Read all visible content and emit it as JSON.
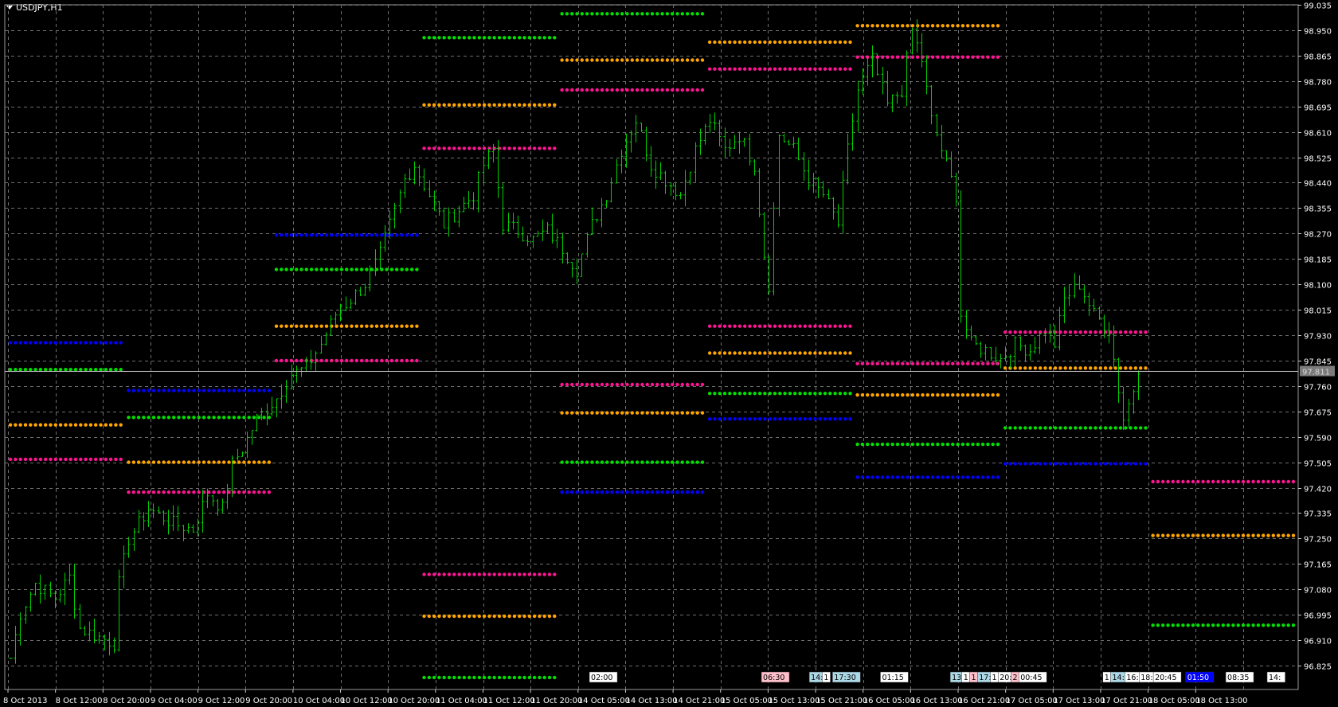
{
  "window": {
    "title": "USDJPY,H1"
  },
  "colors": {
    "background": "#000000",
    "grid": "#6f6f6f",
    "candle": "#00d000",
    "current_line": "#b8b8b8",
    "axis_text": "#ffffff",
    "level_green": "#00e000",
    "level_orange": "#ffa500",
    "level_magenta": "#ff1493",
    "level_blue": "#0000ff"
  },
  "current_price_label": "97.811",
  "chart_data": {
    "type": "candlestick",
    "symbol": "USDJPY",
    "timeframe": "H1",
    "grid": true,
    "ylim": [
      96.78,
      99.035
    ],
    "y_ticks": [
      "99.035",
      "98.950",
      "98.865",
      "98.780",
      "98.695",
      "98.610",
      "98.525",
      "98.440",
      "98.355",
      "98.270",
      "98.185",
      "98.100",
      "98.015",
      "97.930",
      "97.845",
      "97.760",
      "97.675",
      "97.590",
      "97.505",
      "97.420",
      "97.335",
      "97.250",
      "97.165",
      "97.080",
      "96.995",
      "96.910",
      "96.825"
    ],
    "x_ticks": [
      "8 Oct 2013",
      "8 Oct 12:00",
      "8 Oct 20:00",
      "9 Oct 04:00",
      "9 Oct 12:00",
      "9 Oct 20:00",
      "10 Oct 04:00",
      "10 Oct 12:00",
      "10 Oct 20:00",
      "11 Oct 04:00",
      "11 Oct 12:00",
      "11 Oct 20:00",
      "14 Oct 05:00",
      "14 Oct 13:00",
      "14 Oct 21:00",
      "15 Oct 05:00",
      "15 Oct 13:00",
      "15 Oct 21:00",
      "16 Oct 05:00",
      "16 Oct 13:00",
      "16 Oct 21:00",
      "17 Oct 05:00",
      "17 Oct 13:00",
      "17 Oct 21:00",
      "18 Oct 05:00",
      "18 Oct 13:00"
    ],
    "current_price": 97.811,
    "path_keypoints": [
      [
        0,
        96.85
      ],
      [
        2,
        97.0
      ],
      [
        5,
        97.1
      ],
      [
        9,
        97.05
      ],
      [
        12,
        97.12
      ],
      [
        14,
        96.95
      ],
      [
        18,
        96.92
      ],
      [
        21,
        96.9
      ],
      [
        22,
        97.1
      ],
      [
        24,
        97.25
      ],
      [
        28,
        97.35
      ],
      [
        33,
        97.3
      ],
      [
        37,
        97.28
      ],
      [
        40,
        97.4
      ],
      [
        43,
        97.35
      ],
      [
        45,
        97.5
      ],
      [
        47,
        97.55
      ],
      [
        50,
        97.65
      ],
      [
        54,
        97.72
      ],
      [
        57,
        97.8
      ],
      [
        60,
        97.82
      ],
      [
        63,
        97.9
      ],
      [
        66,
        98.0
      ],
      [
        69,
        98.05
      ],
      [
        72,
        98.1
      ],
      [
        75,
        98.2
      ],
      [
        77,
        98.3
      ],
      [
        80,
        98.45
      ],
      [
        82,
        98.5
      ],
      [
        85,
        98.4
      ],
      [
        88,
        98.3
      ],
      [
        91,
        98.35
      ],
      [
        94,
        98.4
      ],
      [
        96,
        98.5
      ],
      [
        98,
        98.55
      ],
      [
        100,
        98.3
      ],
      [
        103,
        98.28
      ],
      [
        106,
        98.25
      ],
      [
        109,
        98.28
      ],
      [
        112,
        98.22
      ],
      [
        115,
        98.15
      ],
      [
        118,
        98.3
      ],
      [
        121,
        98.4
      ],
      [
        124,
        98.55
      ],
      [
        127,
        98.65
      ],
      [
        130,
        98.5
      ],
      [
        133,
        98.45
      ],
      [
        136,
        98.4
      ],
      [
        139,
        98.55
      ],
      [
        142,
        98.65
      ],
      [
        145,
        98.55
      ],
      [
        148,
        98.6
      ],
      [
        151,
        98.5
      ],
      [
        153,
        98.2
      ],
      [
        154,
        98.1
      ],
      [
        156,
        98.6
      ],
      [
        159,
        98.55
      ],
      [
        162,
        98.45
      ],
      [
        165,
        98.4
      ],
      [
        168,
        98.3
      ],
      [
        170,
        98.55
      ],
      [
        172,
        98.75
      ],
      [
        175,
        98.85
      ],
      [
        178,
        98.7
      ],
      [
        181,
        98.75
      ],
      [
        183,
        98.95
      ],
      [
        185,
        98.85
      ],
      [
        187,
        98.65
      ],
      [
        190,
        98.5
      ],
      [
        192,
        98.4
      ],
      [
        193,
        98.0
      ],
      [
        195,
        97.9
      ],
      [
        198,
        97.88
      ],
      [
        201,
        97.85
      ],
      [
        204,
        97.9
      ],
      [
        207,
        97.88
      ],
      [
        210,
        97.95
      ],
      [
        212,
        97.9
      ],
      [
        214,
        98.05
      ],
      [
        217,
        98.1
      ],
      [
        220,
        98.0
      ],
      [
        223,
        97.95
      ],
      [
        225,
        97.75
      ],
      [
        226,
        97.65
      ],
      [
        228,
        97.75
      ],
      [
        229,
        97.8
      ]
    ],
    "level_sets": [
      {
        "x0": 0,
        "x1": 24,
        "levels": [
          {
            "color": "blue",
            "price": 97.905
          },
          {
            "color": "green",
            "price": 97.815
          },
          {
            "color": "orange",
            "price": 97.63
          },
          {
            "color": "magenta",
            "price": 97.515
          }
        ]
      },
      {
        "x0": 24,
        "x1": 54,
        "levels": [
          {
            "color": "blue",
            "price": 97.745
          },
          {
            "color": "green",
            "price": 97.655
          },
          {
            "color": "orange",
            "price": 97.505
          },
          {
            "color": "magenta",
            "price": 97.405
          }
        ]
      },
      {
        "x0": 54,
        "x1": 84,
        "levels": [
          {
            "color": "blue",
            "price": 98.265
          },
          {
            "color": "green",
            "price": 98.15
          },
          {
            "color": "orange",
            "price": 97.96
          },
          {
            "color": "magenta",
            "price": 97.845
          }
        ]
      },
      {
        "x0": 84,
        "x1": 112,
        "levels": [
          {
            "color": "green",
            "price": 98.925
          },
          {
            "color": "orange",
            "price": 98.7
          },
          {
            "color": "magenta",
            "price": 98.555
          },
          {
            "color": "magenta",
            "price": 97.13
          },
          {
            "color": "orange",
            "price": 96.99
          },
          {
            "color": "green",
            "price": 96.785
          }
        ]
      },
      {
        "x0": 112,
        "x1": 142,
        "levels": [
          {
            "color": "green",
            "price": 99.005
          },
          {
            "color": "orange",
            "price": 98.85
          },
          {
            "color": "magenta",
            "price": 98.75
          },
          {
            "color": "magenta",
            "price": 97.765
          },
          {
            "color": "orange",
            "price": 97.67
          },
          {
            "color": "green",
            "price": 97.505
          },
          {
            "color": "blue",
            "price": 97.405
          }
        ]
      },
      {
        "x0": 142,
        "x1": 172,
        "levels": [
          {
            "color": "orange",
            "price": 98.91
          },
          {
            "color": "magenta",
            "price": 98.82
          },
          {
            "color": "magenta",
            "price": 97.96
          },
          {
            "color": "orange",
            "price": 97.87
          },
          {
            "color": "green",
            "price": 97.735
          },
          {
            "color": "blue",
            "price": 97.65
          }
        ]
      },
      {
        "x0": 172,
        "x1": 202,
        "levels": [
          {
            "color": "orange",
            "price": 98.965
          },
          {
            "color": "magenta",
            "price": 98.86
          },
          {
            "color": "magenta",
            "price": 97.835
          },
          {
            "color": "orange",
            "price": 97.73
          },
          {
            "color": "green",
            "price": 97.565
          },
          {
            "color": "blue",
            "price": 97.455
          }
        ]
      },
      {
        "x0": 202,
        "x1": 232,
        "levels": [
          {
            "color": "magenta",
            "price": 97.94
          },
          {
            "color": "orange",
            "price": 97.82
          },
          {
            "color": "green",
            "price": 97.62
          },
          {
            "color": "blue",
            "price": 97.5
          }
        ]
      },
      {
        "x0": 232,
        "x1": 262,
        "levels": [
          {
            "color": "magenta",
            "price": 97.44
          },
          {
            "color": "orange",
            "price": 97.26
          },
          {
            "color": "green",
            "price": 96.96
          }
        ]
      }
    ],
    "event_labels": [
      {
        "text": "02:00",
        "bg": "#ffffff",
        "fg": "#000000",
        "pos": 0.452
      },
      {
        "text": "06:30",
        "bg": "#ffc0cb",
        "fg": "#000000",
        "pos": 0.585
      },
      {
        "text": "14:",
        "bg": "#add8e6",
        "fg": "#000000",
        "pos": 0.622
      },
      {
        "text": "1",
        "bg": "#ffffff",
        "fg": "#000000",
        "pos": 0.632
      },
      {
        "text": "17:30",
        "bg": "#add8e6",
        "fg": "#000000",
        "pos": 0.64
      },
      {
        "text": "01:15",
        "bg": "#ffffff",
        "fg": "#000000",
        "pos": 0.677
      },
      {
        "text": "13:",
        "bg": "#add8e6",
        "fg": "#000000",
        "pos": 0.731
      },
      {
        "text": "1",
        "bg": "#ffffff",
        "fg": "#000000",
        "pos": 0.74
      },
      {
        "text": "1",
        "bg": "#ffc0cb",
        "fg": "#000000",
        "pos": 0.746
      },
      {
        "text": "17:",
        "bg": "#add8e6",
        "fg": "#000000",
        "pos": 0.752
      },
      {
        "text": "1",
        "bg": "#ffffff",
        "fg": "#000000",
        "pos": 0.762
      },
      {
        "text": "20:0",
        "bg": "#ffffff",
        "fg": "#000000",
        "pos": 0.768
      },
      {
        "text": "2",
        "bg": "#ffc0cb",
        "fg": "#000000",
        "pos": 0.778
      },
      {
        "text": "00:45",
        "bg": "#ffffff",
        "fg": "#000000",
        "pos": 0.784
      },
      {
        "text": "1",
        "bg": "#ffffff",
        "fg": "#000000",
        "pos": 0.849
      },
      {
        "text": "14:",
        "bg": "#add8e6",
        "fg": "#000000",
        "pos": 0.855
      },
      {
        "text": "16:",
        "bg": "#ffffff",
        "fg": "#000000",
        "pos": 0.866
      },
      {
        "text": "18:",
        "bg": "#ffffff",
        "fg": "#000000",
        "pos": 0.877
      },
      {
        "text": "20:45",
        "bg": "#ffffff",
        "fg": "#000000",
        "pos": 0.888
      },
      {
        "text": "01:50",
        "bg": "#0000ff",
        "fg": "#ffffff",
        "pos": 0.913
      },
      {
        "text": "08:35",
        "bg": "#ffffff",
        "fg": "#000000",
        "pos": 0.944
      },
      {
        "text": "14:",
        "bg": "#ffffff",
        "fg": "#000000",
        "pos": 0.976
      }
    ]
  }
}
